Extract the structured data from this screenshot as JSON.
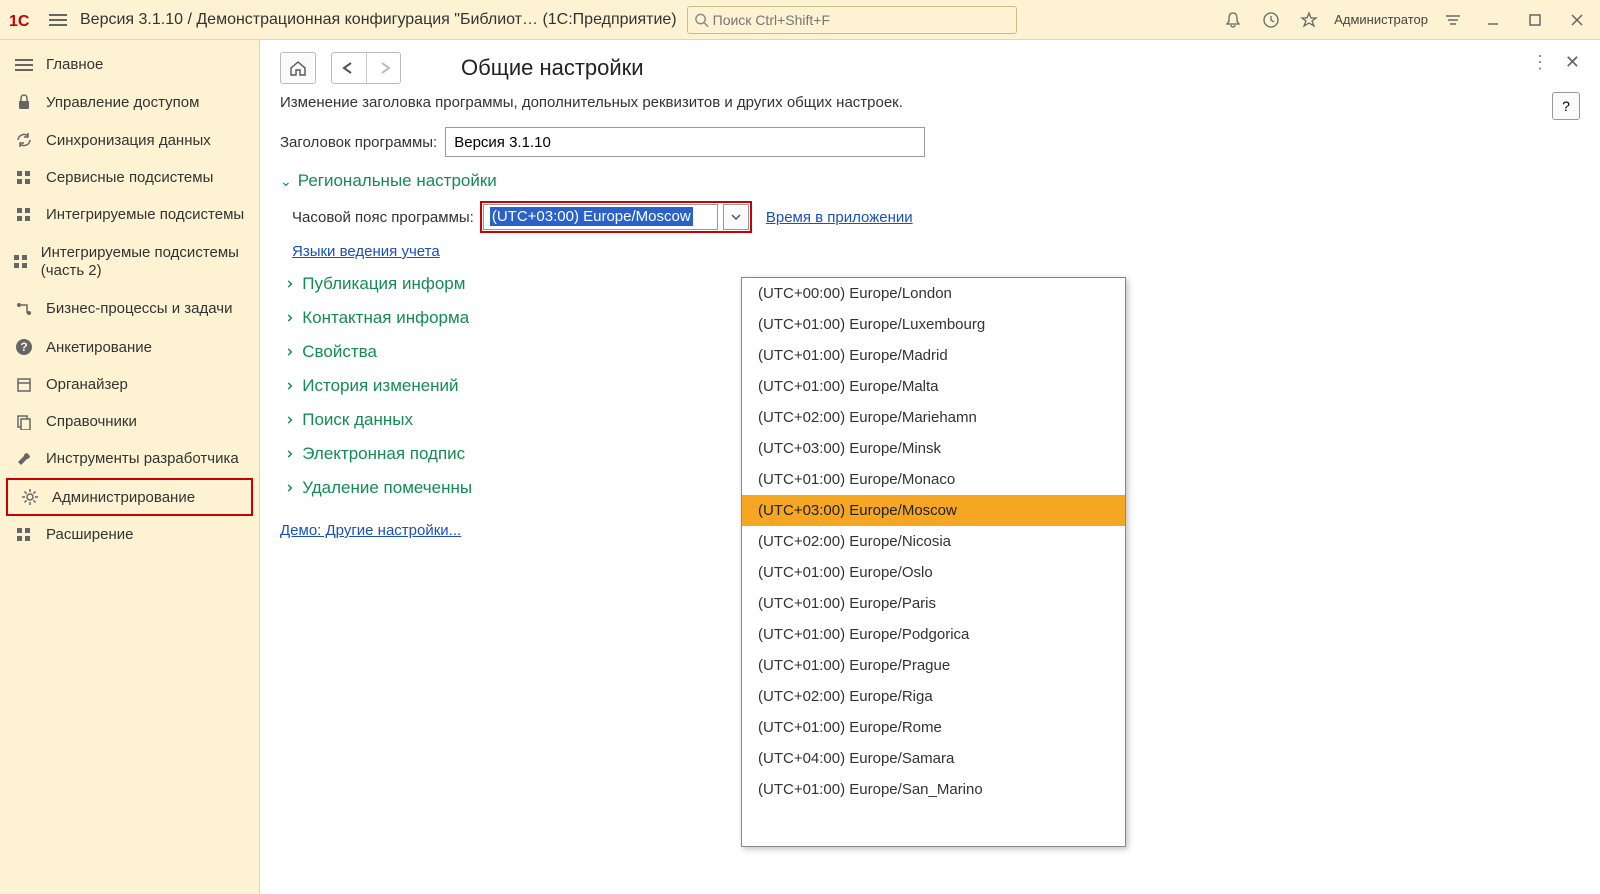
{
  "titlebar": {
    "title": "Версия 3.1.10 / Демонстрационная конфигурация \"Библиот…   (1С:Предприятие)",
    "search_placeholder": "Поиск Ctrl+Shift+F",
    "user": "Администратор"
  },
  "sidebar": {
    "items": [
      {
        "label": "Главное",
        "icon": "menu-icon"
      },
      {
        "label": "Управление доступом",
        "icon": "lock-icon"
      },
      {
        "label": "Синхронизация данных",
        "icon": "sync-icon"
      },
      {
        "label": "Сервисные подсистемы",
        "icon": "blocks-icon"
      },
      {
        "label": "Интегрируемые подсистемы",
        "icon": "blocks-icon"
      },
      {
        "label": "Интегрируемые подсистемы (часть 2)",
        "icon": "blocks-icon"
      },
      {
        "label": "Бизнес-процессы и задачи",
        "icon": "flow-icon"
      },
      {
        "label": "Анкетирование",
        "icon": "question-icon"
      },
      {
        "label": "Органайзер",
        "icon": "organizer-icon"
      },
      {
        "label": "Справочники",
        "icon": "copy-icon"
      },
      {
        "label": "Инструменты разработчика",
        "icon": "wrench-icon"
      },
      {
        "label": "Администрирование",
        "icon": "gear-icon"
      },
      {
        "label": "Расширение",
        "icon": "blocks-icon"
      }
    ]
  },
  "content": {
    "page_title": "Общие настройки",
    "description": "Изменение заголовка программы, дополнительных реквизитов и других общих настроек.",
    "program_title_label": "Заголовок программы:",
    "program_title_value": "Версия 3.1.10",
    "regional_section": "Региональные настройки",
    "timezone_label": "Часовой пояс программы:",
    "timezone_value": "(UTC+03:00) Europe/Moscow",
    "time_in_app_link": "Время в приложении",
    "lang_link": "Языки ведения учета",
    "collapsed_sections": [
      "Публикация информ",
      "Контактная информа",
      "Свойства",
      "История изменений",
      "Поиск данных",
      "Электронная подпис",
      "Удаление помеченны"
    ],
    "demo_link": "Демо: Другие настройки...",
    "help_label": "?"
  },
  "dropdown": {
    "selected_index": 7,
    "items": [
      "(UTC+00:00) Europe/London",
      "(UTC+01:00) Europe/Luxembourg",
      "(UTC+01:00) Europe/Madrid",
      "(UTC+01:00) Europe/Malta",
      "(UTC+02:00) Europe/Mariehamn",
      "(UTC+03:00) Europe/Minsk",
      "(UTC+01:00) Europe/Monaco",
      "(UTC+03:00) Europe/Moscow",
      "(UTC+02:00) Europe/Nicosia",
      "(UTC+01:00) Europe/Oslo",
      "(UTC+01:00) Europe/Paris",
      "(UTC+01:00) Europe/Podgorica",
      "(UTC+01:00) Europe/Prague",
      "(UTC+02:00) Europe/Riga",
      "(UTC+01:00) Europe/Rome",
      "(UTC+04:00) Europe/Samara",
      "(UTC+01:00) Europe/San_Marino"
    ]
  }
}
